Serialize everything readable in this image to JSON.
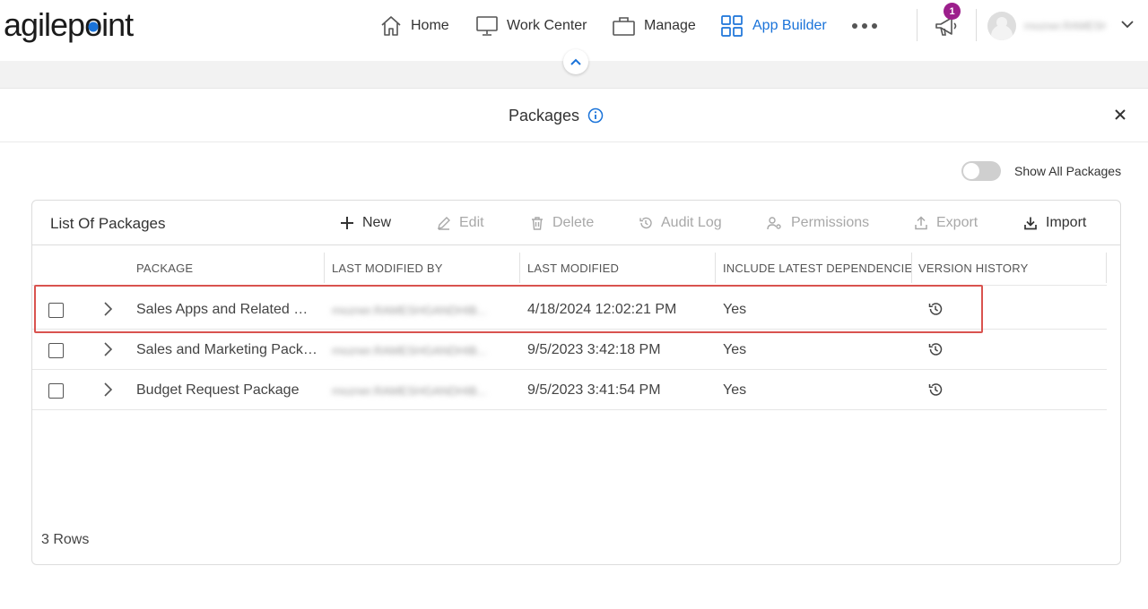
{
  "brand": {
    "logo_text_pre": "agilep",
    "logo_text_dot": "o",
    "logo_text_post": "int",
    "accent": "#1a73d9"
  },
  "nav": {
    "items": [
      {
        "label": "Home",
        "icon": "home-icon"
      },
      {
        "label": "Work Center",
        "icon": "monitor-icon"
      },
      {
        "label": "Manage",
        "icon": "briefcase-icon"
      },
      {
        "label": "App Builder",
        "icon": "grid-icon",
        "active": true
      }
    ],
    "notification_count": "1",
    "user_name": "rnozner.RAMESHGANDHIB..."
  },
  "panel": {
    "title": "Packages",
    "toggle_label": "Show All Packages"
  },
  "list": {
    "title": "List Of Packages",
    "toolbar": {
      "new": "New",
      "edit": "Edit",
      "delete": "Delete",
      "audit_log": "Audit Log",
      "permissions": "Permissions",
      "export": "Export",
      "import": "Import"
    },
    "columns": [
      "PACKAGE",
      "LAST MODIFIED BY",
      "LAST MODIFIED",
      "INCLUDE LATEST DEPENDENCIES",
      "VERSION HISTORY"
    ],
    "rows": [
      {
        "package": "Sales Apps and Related Re...",
        "modified_by": "rnozner.RAMESHGANDHIB...",
        "modified": "4/18/2024 12:02:21 PM",
        "deps": "Yes"
      },
      {
        "package": "Sales and Marketing Packa...",
        "modified_by": "rnozner.RAMESHGANDHIB...",
        "modified": "9/5/2023 3:42:18 PM",
        "deps": "Yes"
      },
      {
        "package": "Budget Request Package",
        "modified_by": "rnozner.RAMESHGANDHIB...",
        "modified": "9/5/2023 3:41:54 PM",
        "deps": "Yes"
      }
    ],
    "row_count": "3 Rows"
  }
}
